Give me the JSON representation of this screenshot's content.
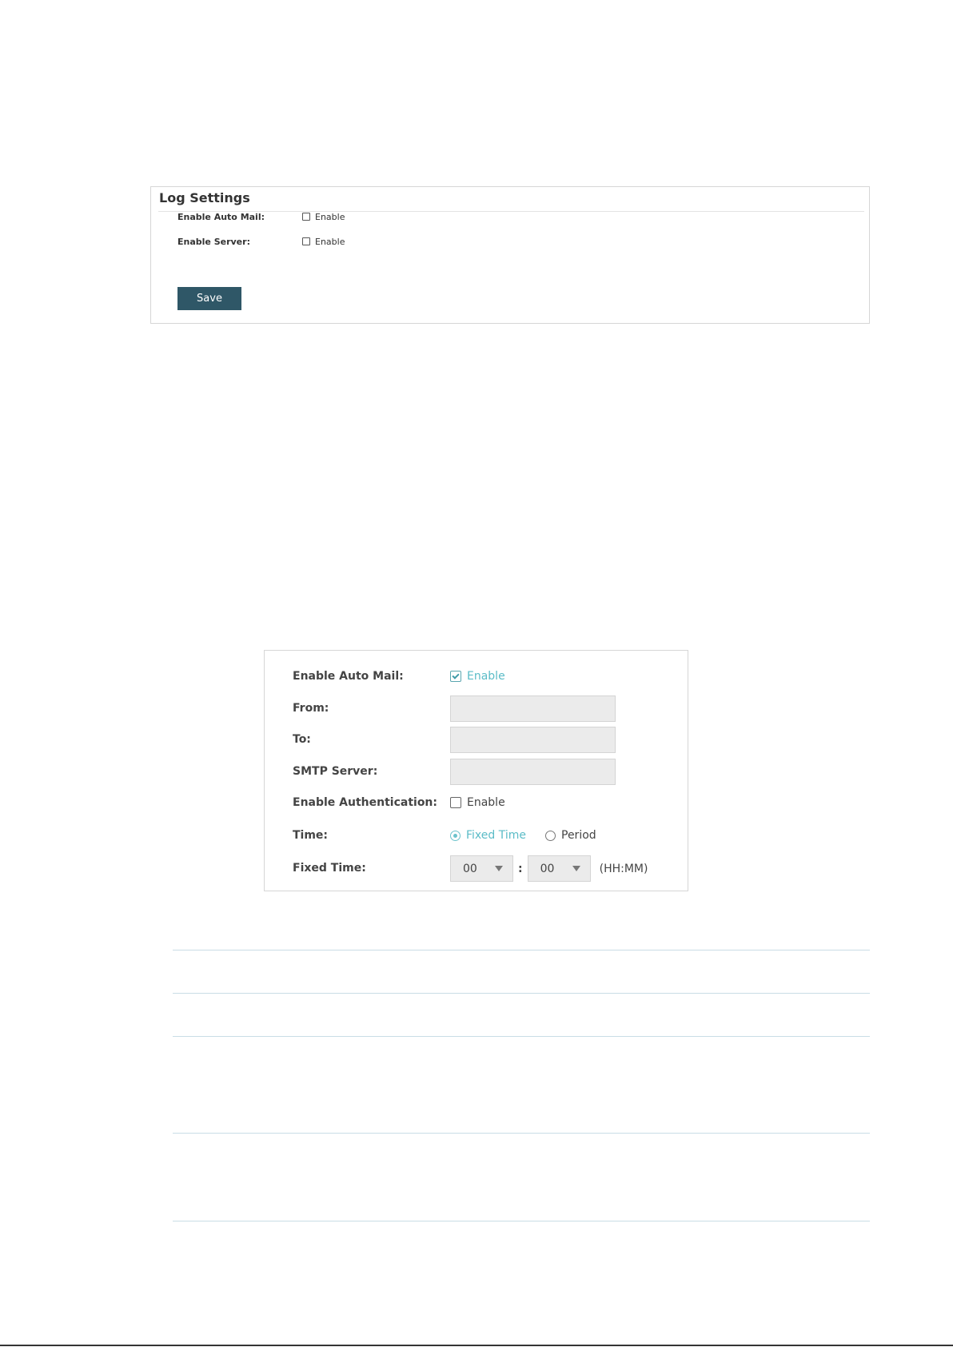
{
  "log_settings": {
    "title": "Log Settings",
    "auto_mail_label": "Enable Auto Mail:",
    "auto_mail_checkbox": "Enable",
    "server_label": "Enable Server:",
    "server_checkbox": "Enable",
    "save_label": "Save"
  },
  "auto_mail": {
    "enable_label": "Enable Auto Mail:",
    "enable_checkbox": "Enable",
    "enable_checked": true,
    "from_label": "From:",
    "from_value": "",
    "to_label": "To:",
    "to_value": "",
    "smtp_label": "SMTP Server:",
    "smtp_value": "",
    "auth_label": "Enable Authentication:",
    "auth_checkbox": "Enable",
    "auth_checked": false,
    "time_label": "Time:",
    "time_options": [
      "Fixed Time",
      "Period"
    ],
    "time_selected": "Fixed Time",
    "fixed_time_label": "Fixed Time:",
    "hour": "00",
    "minute": "00",
    "time_separator": ":",
    "time_unit": "(HH:MM)"
  },
  "colors": {
    "save_button": "#2f5767",
    "accent": "#5bbcc7",
    "table_rule": "#c9dde6"
  }
}
